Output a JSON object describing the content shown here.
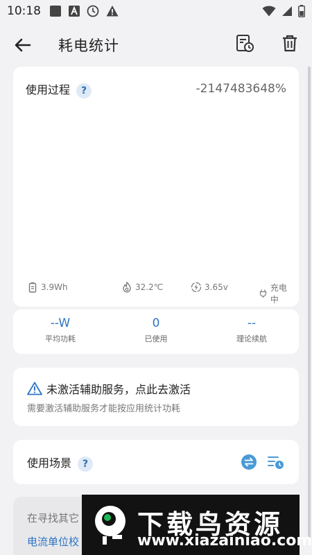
{
  "status_bar": {
    "time": "10:18"
  },
  "header": {
    "title": "耗电统计"
  },
  "usage_card": {
    "title": "使用过程",
    "help": "?",
    "percent": "-2147483648%",
    "metrics": [
      {
        "icon": "battery-icon",
        "value": "3.9Wh"
      },
      {
        "icon": "temperature-icon",
        "value": "32.2℃"
      },
      {
        "icon": "voltage-icon",
        "value": "3.65v"
      },
      {
        "icon": "plug-icon",
        "value": "充电中"
      }
    ]
  },
  "stats": [
    {
      "value": "--W",
      "label": "平均功耗"
    },
    {
      "value": "0",
      "label": "已使用"
    },
    {
      "value": "--",
      "label": "理论续航"
    }
  ],
  "warning": {
    "title": "未激活辅助服务，点此去激活",
    "subtitle": "需要激活辅助服务才能按应用统计功耗"
  },
  "scene": {
    "title": "使用场景",
    "help": "?"
  },
  "bottom": {
    "text": "在寻找其它",
    "link": "电流单位校"
  },
  "watermark": {
    "title": "下载鸟资源",
    "url": "www.xiazainiao.com"
  },
  "colors": {
    "accent": "#2e74c5",
    "help_badge_bg": "#dfeaf7",
    "background": "#f2f2f4"
  }
}
